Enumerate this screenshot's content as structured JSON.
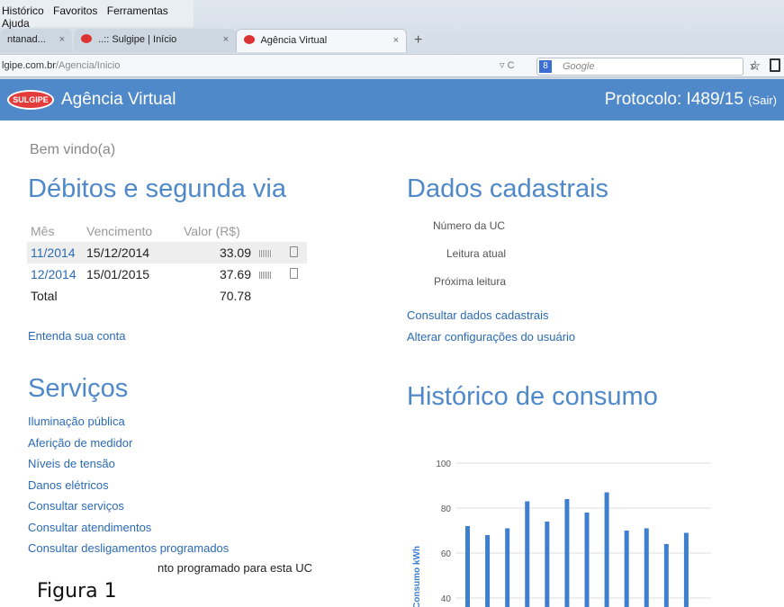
{
  "browser": {
    "menu": [
      "Histórico",
      "Favoritos",
      "Ferramentas",
      "Ajuda"
    ],
    "tabs": [
      {
        "label": "ntanad..."
      },
      {
        "label": "..:: Sulgipe | Início"
      },
      {
        "label": "Agência Virtual"
      }
    ],
    "url_domain": "lgipe.com.br",
    "url_path": "/Agencia/Inicio",
    "search_placeholder": "Google"
  },
  "header": {
    "logo": "SULGIPE",
    "title": "Agência Virtual",
    "protocol": "Protocolo: I489/15",
    "logout": "(Sair)"
  },
  "welcome": "Bem vindo(a)",
  "debitos": {
    "title": "Débitos e segunda via",
    "columns": [
      "Mês",
      "Vencimento",
      "Valor (R$)"
    ],
    "rows": [
      {
        "mes": "11/2014",
        "vencimento": "15/12/2014",
        "valor": "33.09"
      },
      {
        "mes": "12/2014",
        "vencimento": "15/01/2015",
        "valor": "37.69"
      }
    ],
    "total_label": "Total",
    "total_value": "70.78",
    "link": "Entenda sua conta"
  },
  "servicos": {
    "title": "Serviços",
    "items": [
      "Iluminação pública",
      "Aferição de medidor",
      "Níveis de tensão",
      "Danos elétricos",
      "Consultar serviços",
      "Consultar atendimentos",
      "Consultar desligamentos programados"
    ],
    "partial_text": "nto programado para esta UC"
  },
  "dados": {
    "title": "Dados cadastrais",
    "fields": [
      "Número da UC",
      "Leitura atual",
      "Próxima leitura"
    ],
    "links": [
      "Consultar dados cadastrais",
      "Alterar configurações do usuário"
    ]
  },
  "historico": {
    "title": "Histórico de consumo"
  },
  "chart_data": {
    "type": "bar",
    "ylabel": "Consumo kWh",
    "yticks": [
      40,
      60,
      80,
      100
    ],
    "ylim": [
      36,
      104
    ],
    "values": [
      72,
      68,
      71,
      83,
      74,
      84,
      78,
      87,
      70,
      71,
      64,
      69
    ],
    "color": "#3f7fd0",
    "grid": true
  },
  "figure_label": "Figura 1"
}
